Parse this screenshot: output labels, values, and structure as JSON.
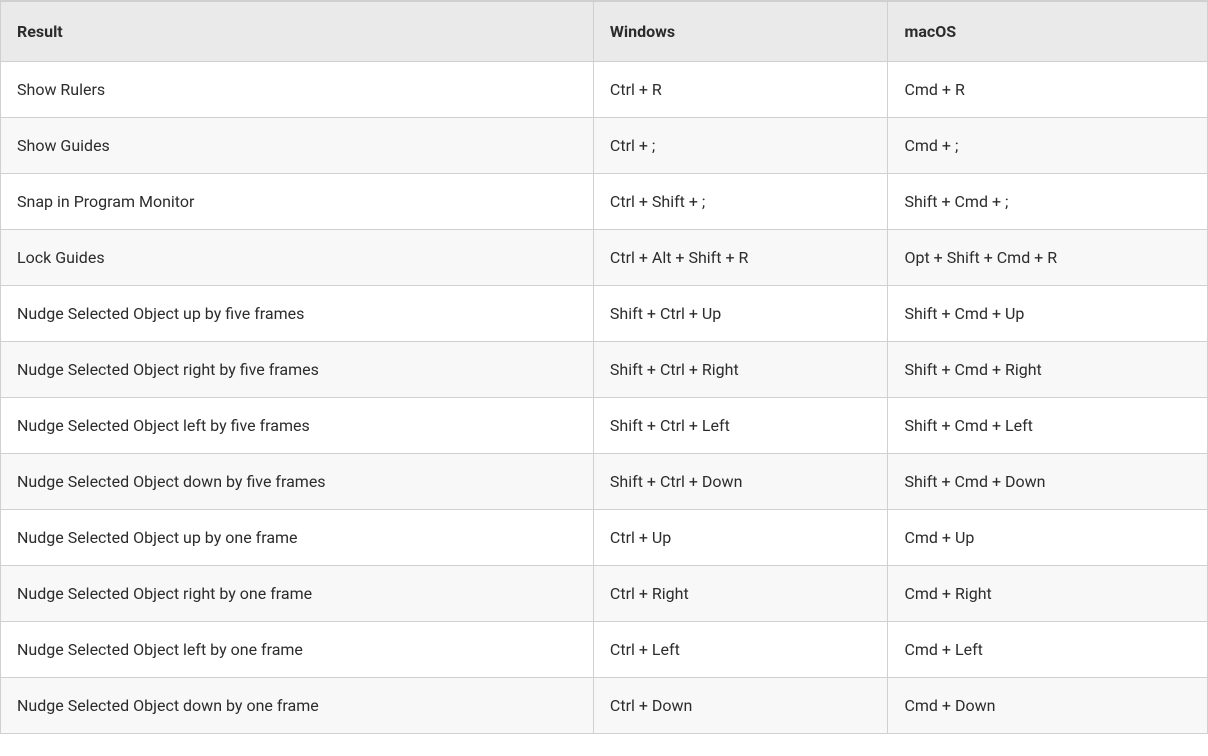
{
  "table": {
    "headers": {
      "result": "Result",
      "windows": "Windows",
      "macos": "macOS"
    },
    "rows": [
      {
        "result": "Show Rulers",
        "windows": "Ctrl + R",
        "macos": "Cmd + R"
      },
      {
        "result": "Show Guides",
        "windows": "Ctrl + ;",
        "macos": "Cmd + ;"
      },
      {
        "result": "Snap in Program Monitor",
        "windows": "Ctrl + Shift + ;",
        "macos": "Shift + Cmd + ;"
      },
      {
        "result": "Lock Guides",
        "windows": "Ctrl + Alt + Shift + R",
        "macos": "Opt + Shift + Cmd + R"
      },
      {
        "result": "Nudge Selected Object up by five frames",
        "windows": "Shift + Ctrl + Up",
        "macos": "Shift + Cmd + Up"
      },
      {
        "result": "Nudge Selected Object right by five frames",
        "windows": "Shift + Ctrl + Right",
        "macos": "Shift + Cmd + Right"
      },
      {
        "result": "Nudge Selected Object left by five frames",
        "windows": "Shift + Ctrl + Left",
        "macos": "Shift + Cmd + Left"
      },
      {
        "result": "Nudge Selected Object down by five frames",
        "windows": "Shift + Ctrl + Down",
        "macos": "Shift + Cmd + Down"
      },
      {
        "result": "Nudge Selected Object up by one frame",
        "windows": "Ctrl + Up",
        "macos": "Cmd + Up"
      },
      {
        "result": "Nudge Selected Object right by one frame",
        "windows": "Ctrl + Right",
        "macos": "Cmd + Right"
      },
      {
        "result": "Nudge Selected Object left by one frame",
        "windows": "Ctrl + Left",
        "macos": "Cmd + Left"
      },
      {
        "result": "Nudge Selected Object down by one frame",
        "windows": "Ctrl + Down",
        "macos": "Cmd + Down"
      }
    ]
  }
}
